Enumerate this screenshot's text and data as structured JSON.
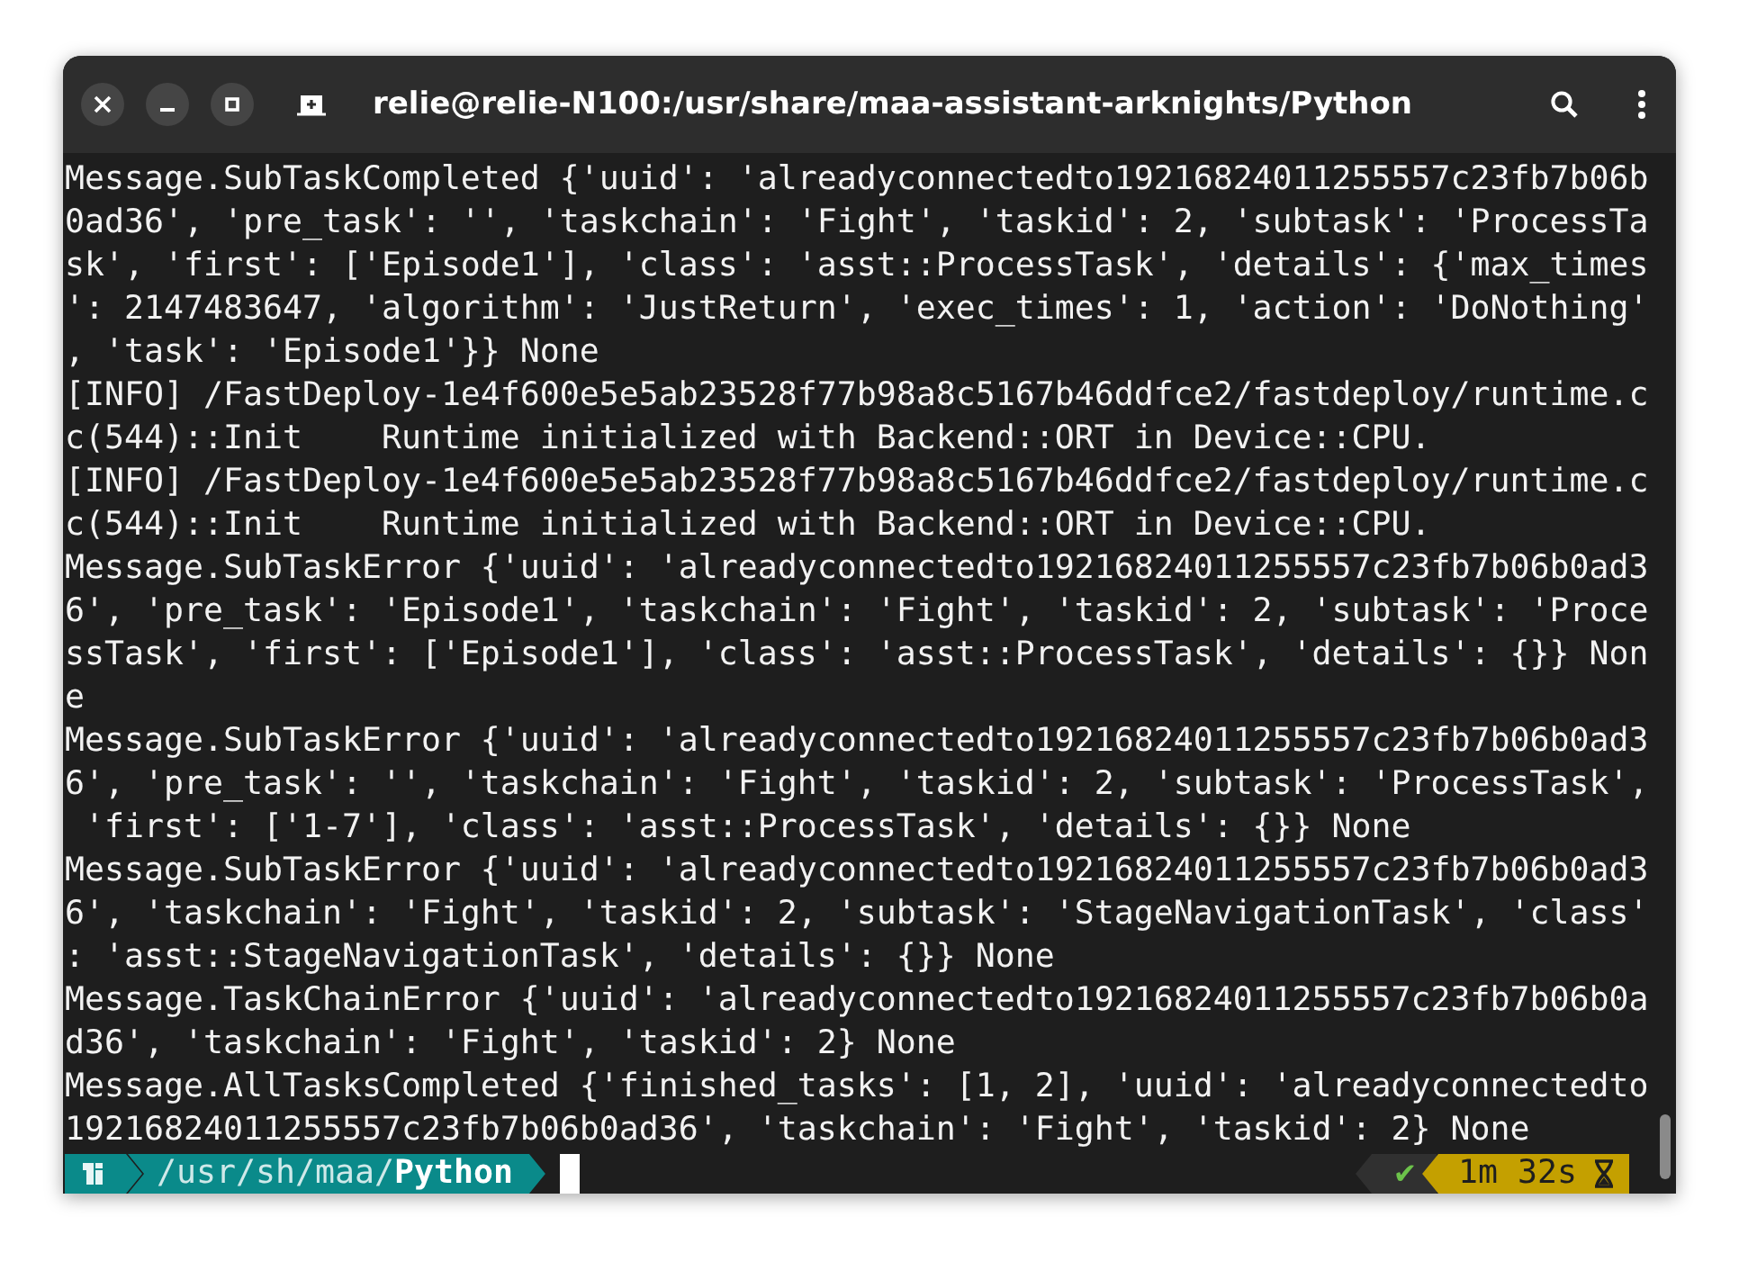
{
  "window": {
    "title": "relie@relie-N100:/usr/share/maa-assistant-arknights/Python"
  },
  "terminal": {
    "lines": [
      "Message.SubTaskCompleted {'uuid': 'alreadyconnectedto19216824011255557c23fb7b06b",
      "0ad36', 'pre_task': '', 'taskchain': 'Fight', 'taskid': 2, 'subtask': 'ProcessTa",
      "sk', 'first': ['Episode1'], 'class': 'asst::ProcessTask', 'details': {'max_times",
      "': 2147483647, 'algorithm': 'JustReturn', 'exec_times': 1, 'action': 'DoNothing'",
      ", 'task': 'Episode1'}} None",
      "[INFO] /FastDeploy-1e4f600e5e5ab23528f77b98a8c5167b46ddfce2/fastdeploy/runtime.c",
      "c(544)::Init    Runtime initialized with Backend::ORT in Device::CPU.",
      "[INFO] /FastDeploy-1e4f600e5e5ab23528f77b98a8c5167b46ddfce2/fastdeploy/runtime.c",
      "c(544)::Init    Runtime initialized with Backend::ORT in Device::CPU.",
      "Message.SubTaskError {'uuid': 'alreadyconnectedto19216824011255557c23fb7b06b0ad3",
      "6', 'pre_task': 'Episode1', 'taskchain': 'Fight', 'taskid': 2, 'subtask': 'Proce",
      "ssTask', 'first': ['Episode1'], 'class': 'asst::ProcessTask', 'details': {}} Non",
      "e",
      "Message.SubTaskError {'uuid': 'alreadyconnectedto19216824011255557c23fb7b06b0ad3",
      "6', 'pre_task': '', 'taskchain': 'Fight', 'taskid': 2, 'subtask': 'ProcessTask',",
      " 'first': ['1-7'], 'class': 'asst::ProcessTask', 'details': {}} None",
      "Message.SubTaskError {'uuid': 'alreadyconnectedto19216824011255557c23fb7b06b0ad3",
      "6', 'taskchain': 'Fight', 'taskid': 2, 'subtask': 'StageNavigationTask', 'class'",
      ": 'asst::StageNavigationTask', 'details': {}} None",
      "Message.TaskChainError {'uuid': 'alreadyconnectedto19216824011255557c23fb7b06b0a",
      "d36', 'taskchain': 'Fight', 'taskid': 2} None",
      "Message.AllTasksCompleted {'finished_tasks': [1, 2], 'uuid': 'alreadyconnectedto",
      "19216824011255557c23fb7b06b0ad36', 'taskchain': 'Fight', 'taskid': 2} None"
    ]
  },
  "prompt": {
    "path": "/usr/sh/maa/**Python**",
    "status": "✔",
    "duration": "1m 32s"
  }
}
